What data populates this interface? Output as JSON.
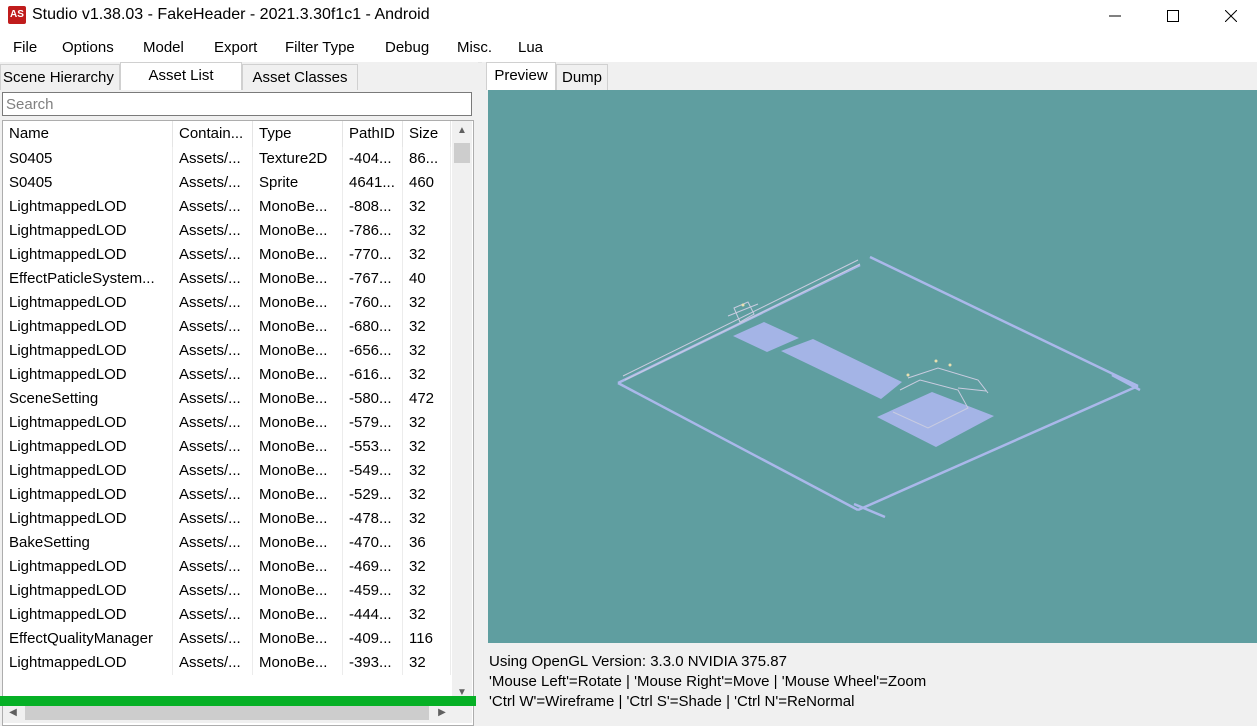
{
  "window": {
    "app_icon": "AS",
    "title": "Studio v1.38.03 - FakeHeader - 2021.3.30f1c1 - Android",
    "minimize_icon": "minimize-icon",
    "maximize_icon": "maximize-icon",
    "close_icon": "close-icon"
  },
  "menu": [
    "File",
    "Options",
    "Model",
    "Export",
    "Filter Type",
    "Debug",
    "Misc.",
    "Lua"
  ],
  "left_tabs": [
    "Scene Hierarchy",
    "Asset List",
    "Asset Classes"
  ],
  "search": {
    "placeholder": "Search",
    "value": ""
  },
  "table": {
    "columns": [
      "Name",
      "Contain...",
      "Type",
      "PathID",
      "Size"
    ],
    "rows": [
      [
        "S0405",
        "Assets/...",
        "Texture2D",
        "-404...",
        "86..."
      ],
      [
        "S0405",
        "Assets/...",
        "Sprite",
        "4641...",
        "460"
      ],
      [
        "LightmappedLOD",
        "Assets/...",
        "MonoBe...",
        "-808...",
        "32"
      ],
      [
        "LightmappedLOD",
        "Assets/...",
        "MonoBe...",
        "-786...",
        "32"
      ],
      [
        "LightmappedLOD",
        "Assets/...",
        "MonoBe...",
        "-770...",
        "32"
      ],
      [
        "EffectPaticleSystem...",
        "Assets/...",
        "MonoBe...",
        "-767...",
        "40"
      ],
      [
        "LightmappedLOD",
        "Assets/...",
        "MonoBe...",
        "-760...",
        "32"
      ],
      [
        "LightmappedLOD",
        "Assets/...",
        "MonoBe...",
        "-680...",
        "32"
      ],
      [
        "LightmappedLOD",
        "Assets/...",
        "MonoBe...",
        "-656...",
        "32"
      ],
      [
        "LightmappedLOD",
        "Assets/...",
        "MonoBe...",
        "-616...",
        "32"
      ],
      [
        "SceneSetting",
        "Assets/...",
        "MonoBe...",
        "-580...",
        "472"
      ],
      [
        "LightmappedLOD",
        "Assets/...",
        "MonoBe...",
        "-579...",
        "32"
      ],
      [
        "LightmappedLOD",
        "Assets/...",
        "MonoBe...",
        "-553...",
        "32"
      ],
      [
        "LightmappedLOD",
        "Assets/...",
        "MonoBe...",
        "-549...",
        "32"
      ],
      [
        "LightmappedLOD",
        "Assets/...",
        "MonoBe...",
        "-529...",
        "32"
      ],
      [
        "LightmappedLOD",
        "Assets/...",
        "MonoBe...",
        "-478...",
        "32"
      ],
      [
        "BakeSetting",
        "Assets/...",
        "MonoBe...",
        "-470...",
        "36"
      ],
      [
        "LightmappedLOD",
        "Assets/...",
        "MonoBe...",
        "-469...",
        "32"
      ],
      [
        "LightmappedLOD",
        "Assets/...",
        "MonoBe...",
        "-459...",
        "32"
      ],
      [
        "LightmappedLOD",
        "Assets/...",
        "MonoBe...",
        "-444...",
        "32"
      ],
      [
        "EffectQualityManager",
        "Assets/...",
        "MonoBe...",
        "-409...",
        "116"
      ],
      [
        "LightmappedLOD",
        "Assets/...",
        "MonoBe...",
        "-393...",
        "32"
      ]
    ]
  },
  "right_tabs": [
    "Preview",
    "Dump"
  ],
  "viewport_color": "#5f9ea0",
  "status_lines": [
    "Using OpenGL Version: 3.3.0 NVIDIA 375.87",
    "'Mouse Left'=Rotate | 'Mouse Right'=Move | 'Mouse Wheel'=Zoom",
    "'Ctrl W'=Wireframe | 'Ctrl S'=Shade | 'Ctrl N'=ReNormal"
  ],
  "progress_color": "#06b025"
}
